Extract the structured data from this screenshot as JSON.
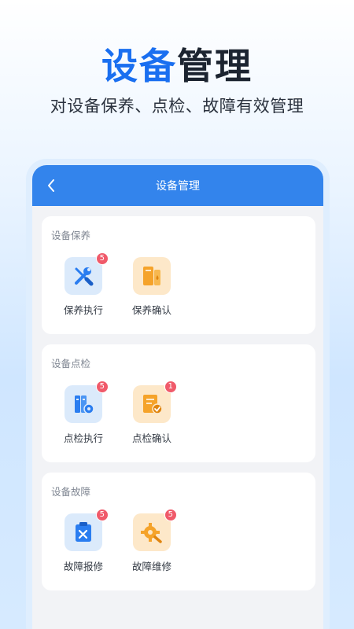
{
  "hero": {
    "title_accent": "设备",
    "title_rest": "管理",
    "subtitle": "对设备保养、点检、故障有效管理"
  },
  "app": {
    "nav_title": "设备管理",
    "accent_color": "#3384ec",
    "badge_color": "#f05a6a"
  },
  "sections": [
    {
      "title": "设备保养",
      "items": [
        {
          "label": "保养执行",
          "badge": "5",
          "icon": "wrench-screwdriver-icon"
        },
        {
          "label": "保养确认",
          "badge": "",
          "icon": "cabinet-drop-icon"
        }
      ]
    },
    {
      "title": "设备点检",
      "items": [
        {
          "label": "点检执行",
          "badge": "5",
          "icon": "binders-gear-icon"
        },
        {
          "label": "点检确认",
          "badge": "1",
          "icon": "document-check-icon"
        }
      ]
    },
    {
      "title": "设备故障",
      "items": [
        {
          "label": "故障报修",
          "badge": "5",
          "icon": "clipboard-tools-icon"
        },
        {
          "label": "故障维修",
          "badge": "5",
          "icon": "gear-wrench-icon"
        }
      ]
    }
  ]
}
